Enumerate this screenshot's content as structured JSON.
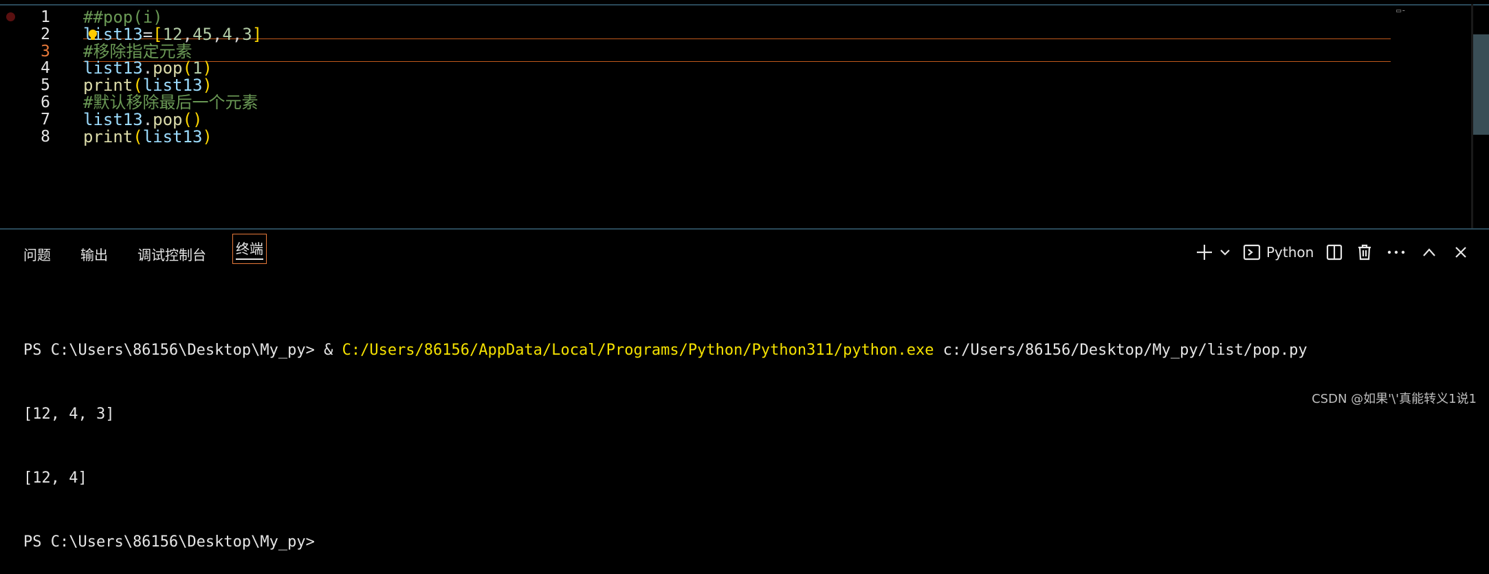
{
  "editor": {
    "lines": [
      {
        "num": "1",
        "tokens": [
          {
            "t": "##pop(i)",
            "c": "comment"
          }
        ]
      },
      {
        "num": "2",
        "tokens": [
          {
            "t": "list13",
            "c": "var"
          },
          {
            "t": "=",
            "c": "pl"
          },
          {
            "t": "[",
            "c": "brk"
          },
          {
            "t": "12",
            "c": "num"
          },
          {
            "t": ",",
            "c": "pl"
          },
          {
            "t": "45",
            "c": "num"
          },
          {
            "t": ",",
            "c": "pl"
          },
          {
            "t": "4",
            "c": "num"
          },
          {
            "t": ",",
            "c": "pl"
          },
          {
            "t": "3",
            "c": "num"
          },
          {
            "t": "]",
            "c": "brk"
          }
        ]
      },
      {
        "num": "3",
        "tokens": [
          {
            "t": "#移除指定元素",
            "c": "comment"
          }
        ],
        "active": true
      },
      {
        "num": "4",
        "tokens": [
          {
            "t": "list13",
            "c": "var"
          },
          {
            "t": ".",
            "c": "pl"
          },
          {
            "t": "pop",
            "c": "fn"
          },
          {
            "t": "(",
            "c": "brk"
          },
          {
            "t": "1",
            "c": "num"
          },
          {
            "t": ")",
            "c": "brk"
          }
        ]
      },
      {
        "num": "5",
        "tokens": [
          {
            "t": "print",
            "c": "fn"
          },
          {
            "t": "(",
            "c": "brk"
          },
          {
            "t": "list13",
            "c": "var"
          },
          {
            "t": ")",
            "c": "brk"
          }
        ]
      },
      {
        "num": "6",
        "tokens": [
          {
            "t": "#默认移除最后一个元素",
            "c": "comment"
          }
        ]
      },
      {
        "num": "7",
        "tokens": [
          {
            "t": "list13",
            "c": "var"
          },
          {
            "t": ".",
            "c": "pl"
          },
          {
            "t": "pop",
            "c": "fn"
          },
          {
            "t": "()",
            "c": "brk"
          }
        ]
      },
      {
        "num": "8",
        "tokens": [
          {
            "t": "print",
            "c": "fn"
          },
          {
            "t": "(",
            "c": "brk"
          },
          {
            "t": "list13",
            "c": "var"
          },
          {
            "t": ")",
            "c": "brk"
          }
        ]
      }
    ]
  },
  "panel": {
    "tabs": [
      {
        "id": "problems",
        "label": "问题"
      },
      {
        "id": "output",
        "label": "输出"
      },
      {
        "id": "debug-console",
        "label": "调试控制台"
      },
      {
        "id": "terminal",
        "label": "终端",
        "active": true
      }
    ],
    "terminal_profile": "Python",
    "icons": [
      "plus-icon",
      "chevron-down-icon",
      "terminal-icon",
      "split-icon",
      "trash-icon",
      "more-icon",
      "chevron-up-icon",
      "close-icon"
    ]
  },
  "terminal": {
    "line1_prompt": "PS C:\\Users\\86156\\Desktop\\My_py> & ",
    "line1_exe": "C:/Users/86156/AppData/Local/Programs/Python/Python311/python.exe",
    "line1_script": " c:/Users/86156/Desktop/My_py/list/pop.py",
    "line2": "[12, 4, 3]",
    "line3": "[12, 4]",
    "line4": "PS C:\\Users\\86156\\Desktop\\My_py> "
  },
  "watermark": "CSDN @如果'\\'真能转义1说1",
  "colors": {
    "comment": "#6a9955",
    "variable": "#9cdcfe",
    "number": "#b5cea8",
    "function": "#dcdcaa",
    "bracket": "#ffd700",
    "exe_path": "#f5e100",
    "active_border": "#e97a3a"
  }
}
